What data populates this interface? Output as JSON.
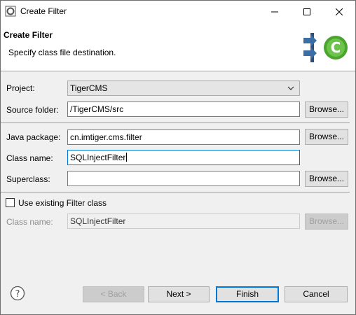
{
  "window": {
    "title": "Create Filter"
  },
  "header": {
    "title": "Create Filter",
    "description": "Specify class file destination."
  },
  "form": {
    "project_label": "Project:",
    "project_value": "TigerCMS",
    "source_folder_label": "Source folder:",
    "source_folder_value": "/TigerCMS/src",
    "java_package_label": "Java package:",
    "java_package_value": "cn.imtiger.cms.filter",
    "class_name_label": "Class name:",
    "class_name_value": "SQLInjectFilter",
    "superclass_label": "Superclass:",
    "superclass_value": "",
    "use_existing_label": "Use existing Filter class",
    "use_existing_checked": false,
    "existing_class_label": "Class name:",
    "existing_class_value": "SQLInjectFilter",
    "browse_label": "Browse..."
  },
  "footer": {
    "back_label": "< Back",
    "next_label": "Next >",
    "finish_label": "Finish",
    "cancel_label": "Cancel"
  },
  "colors": {
    "focus": "#0078d7",
    "logo_green": "#5fb83a"
  }
}
